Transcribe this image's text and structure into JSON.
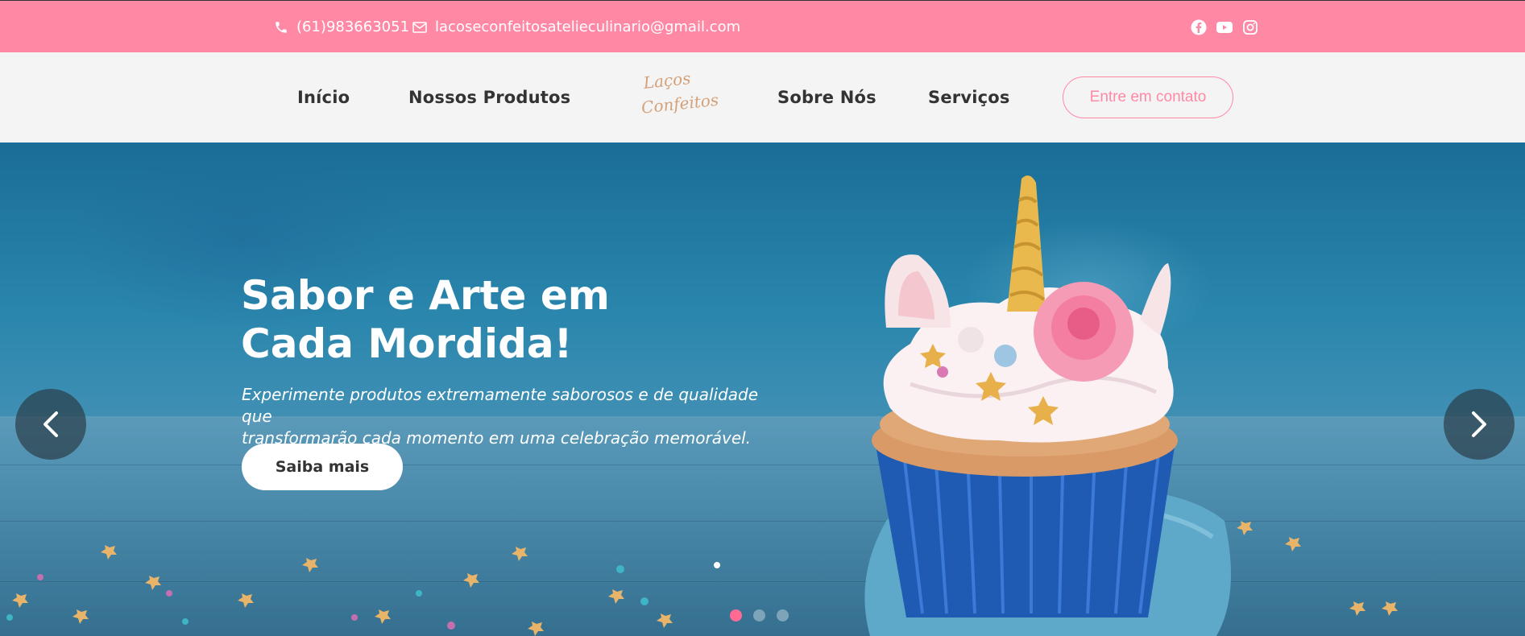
{
  "topbar": {
    "phone": "(61)983663051",
    "email": "lacoseconfeitosatelieculinario@gmail.com",
    "social_icons": [
      "facebook-icon",
      "youtube-icon",
      "instagram-icon"
    ]
  },
  "nav": {
    "items": [
      {
        "label": "Início"
      },
      {
        "label": "Nossos Produtos"
      },
      {
        "label": "Sobre Nós"
      },
      {
        "label": "Serviços"
      }
    ],
    "logo_line1": "Laços",
    "logo_line2": "Confeitos",
    "cta": "Entre em contato"
  },
  "hero": {
    "title_line1": "Sabor e Arte em",
    "title_line2": "Cada Mordida!",
    "subtitle_line1": "Experimente produtos extremamente saborosos e de qualidade que",
    "subtitle_line2": "transformarão cada momento em uma celebração memorável.",
    "button": "Saiba mais",
    "slides_count": 3,
    "active_slide": 1
  },
  "colors": {
    "brand_pink": "#ff89a5",
    "dot_active": "#ff6b93",
    "nav_text": "#333333",
    "logo_gold": "#d4a17a"
  }
}
